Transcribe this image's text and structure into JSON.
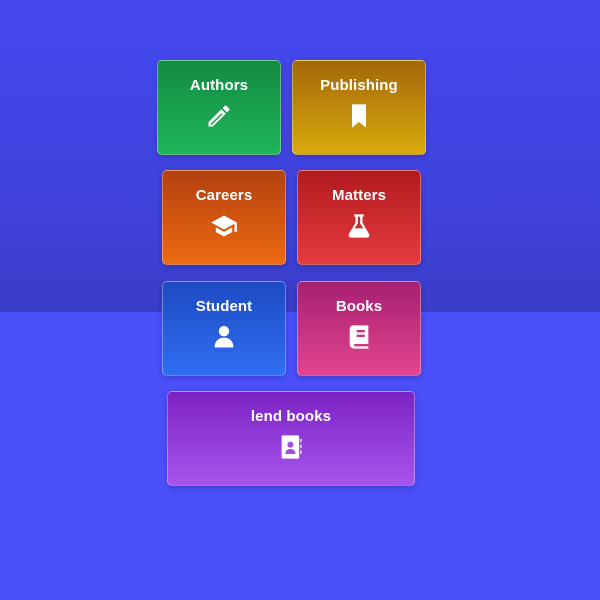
{
  "tiles": {
    "authors": {
      "label": "Authors",
      "icon": "pencil-icon"
    },
    "publishing": {
      "label": "Publishing",
      "icon": "bookmark-icon"
    },
    "careers": {
      "label": "Careers",
      "icon": "graduation-cap-icon"
    },
    "matters": {
      "label": "Matters",
      "icon": "flask-icon"
    },
    "student": {
      "label": "Student",
      "icon": "user-icon"
    },
    "books": {
      "label": "Books",
      "icon": "book-icon"
    },
    "lend": {
      "label": "lend books",
      "icon": "address-book-icon"
    }
  },
  "colors": {
    "background": "#4a4ff6",
    "authors": "#1a9f4f",
    "publishing": "#c08a0c",
    "careers": "#d85510",
    "matters": "#d02a2f",
    "student": "#275ce0",
    "books": "#c83280",
    "lend": "#903bd8"
  }
}
